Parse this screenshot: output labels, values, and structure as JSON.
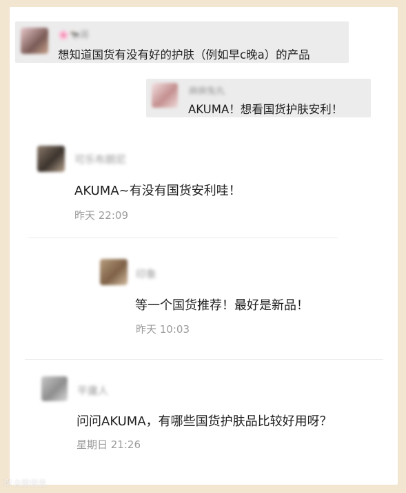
{
  "comments": [
    {
      "name": "🌸🐄蒋",
      "text": "想知道国货有没有好的护肤（例如早c晚a）的产品",
      "time": ""
    },
    {
      "name": "麻麻兔丸",
      "text": "AKUMA！想看国货护肤安利！",
      "time": ""
    },
    {
      "name": "可乐布朗尼",
      "text": "AKUMA~有没有国货安利哇！",
      "time": "昨天 22:09"
    },
    {
      "name": "印象",
      "text": "等一个国货推荐！最好是新品！",
      "time": "昨天 10:03"
    },
    {
      "name": "平庸人",
      "text": "问问AKUMA，有哪些国货护肤品比较好用呀？",
      "time": "星期日 21:26"
    }
  ],
  "watermark": "大歌说说"
}
